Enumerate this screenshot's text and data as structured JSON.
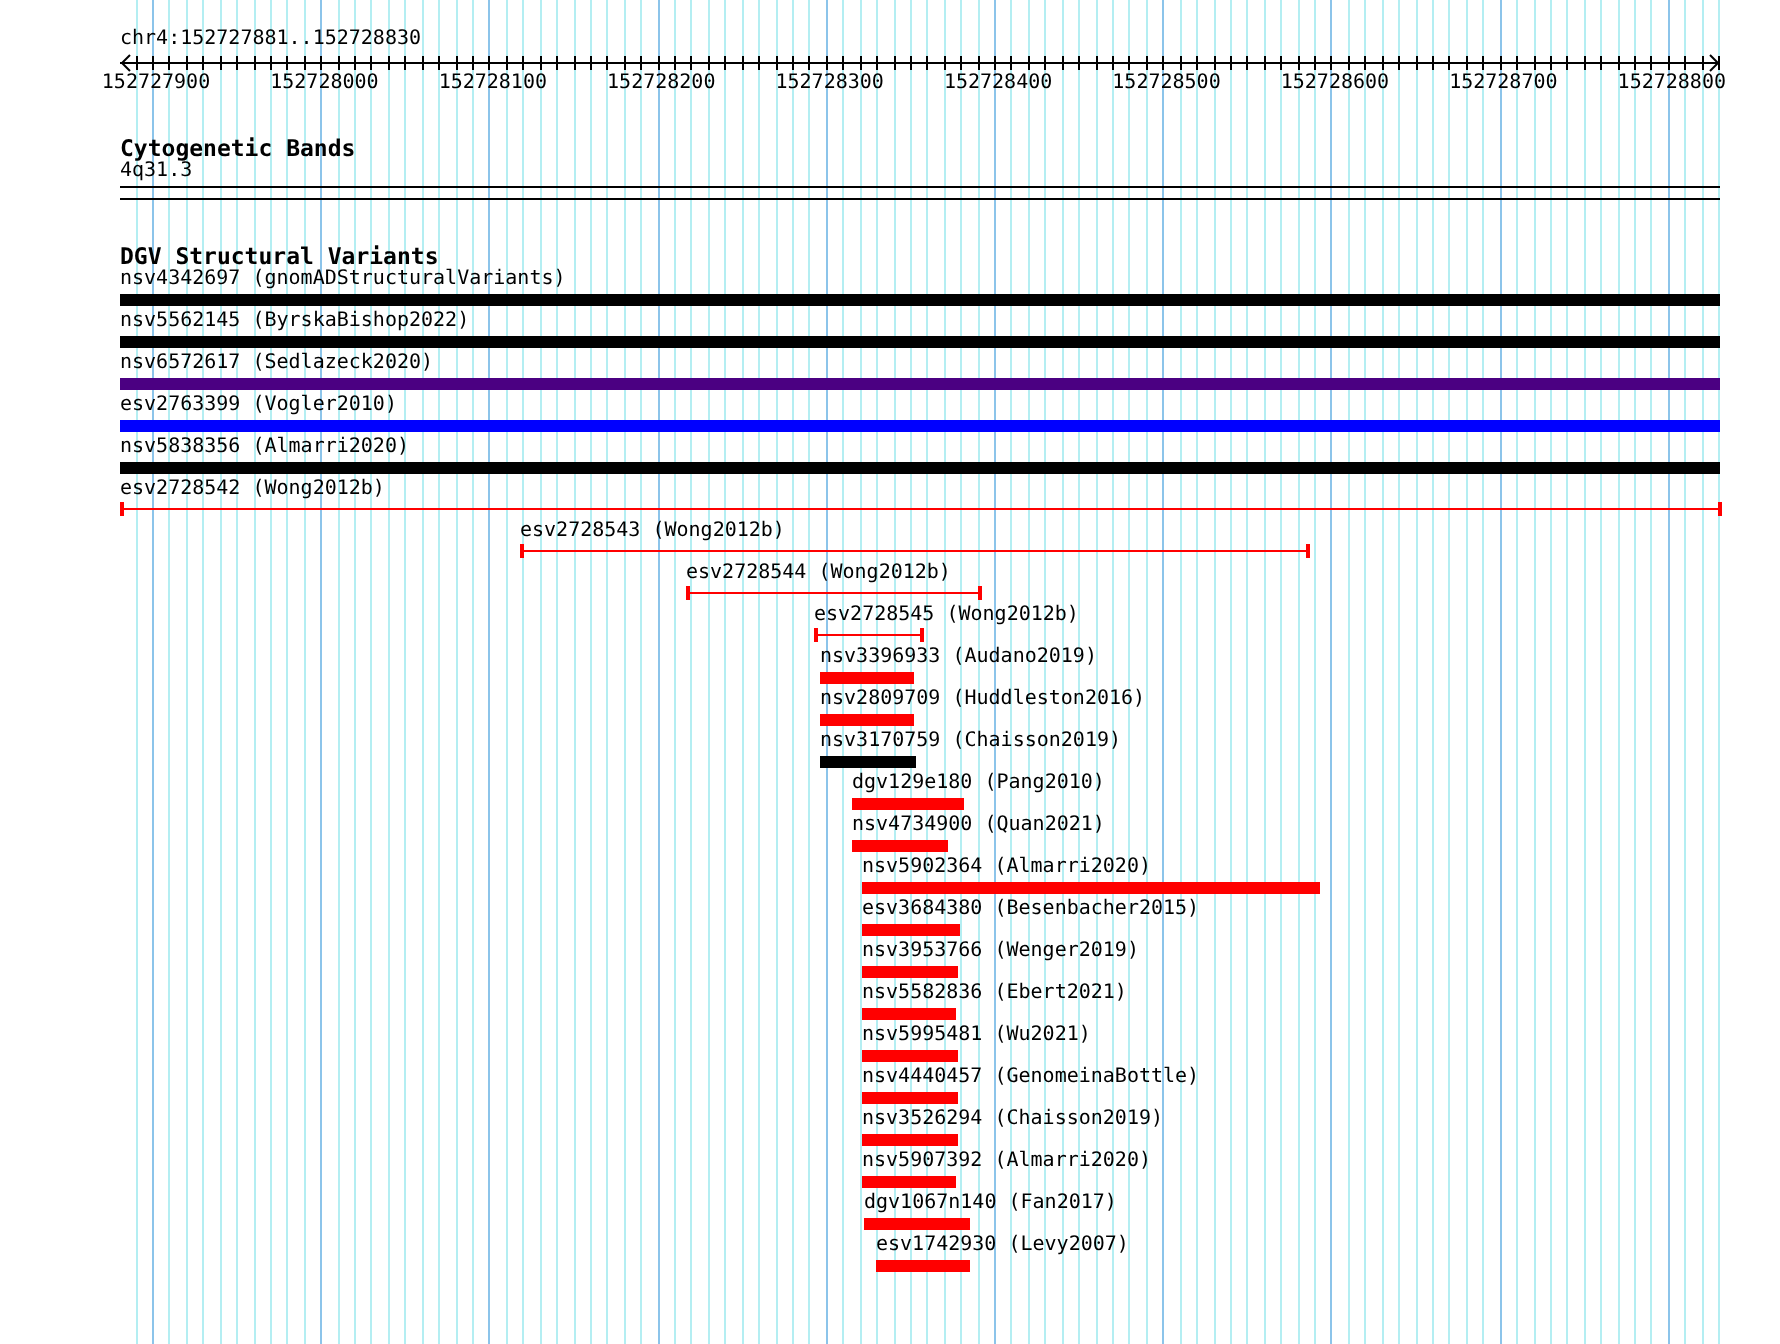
{
  "ruler": {
    "location": "chr4:152727881..152728830",
    "ticks": [
      "152727900",
      "152728000",
      "152728100",
      "152728200",
      "152728300",
      "152728400",
      "152728500",
      "152728600",
      "152728700",
      "152728800"
    ]
  },
  "tracks": [
    {
      "kind": "bands",
      "title": "Cytogenetic Bands",
      "bands": [
        {
          "name": "4q31.3"
        }
      ]
    },
    {
      "kind": "variants",
      "title": "DGV Structural Variants",
      "features": [
        {
          "label": "nsv4342697 (gnomADStructuralVariants)",
          "kind": "bar",
          "color": "#000000"
        },
        {
          "label": "nsv5562145 (ByrskaBishop2022)",
          "kind": "bar",
          "color": "#000000"
        },
        {
          "label": "nsv6572617 (Sedlazeck2020)",
          "kind": "bar",
          "color": "#4b0082"
        },
        {
          "label": "esv2763399 (Vogler2010)",
          "kind": "bar",
          "color": "#0000ff"
        },
        {
          "label": "nsv5838356 (Almarri2020)",
          "kind": "bar",
          "color": "#000000"
        },
        {
          "label": "esv2728542 (Wong2012b)",
          "kind": "range",
          "color": "#ff0000"
        },
        {
          "label": "esv2728543 (Wong2012b)",
          "kind": "range",
          "color": "#ff0000"
        },
        {
          "label": "esv2728544 (Wong2012b)",
          "kind": "range",
          "color": "#ff0000"
        },
        {
          "label": "esv2728545 (Wong2012b)",
          "kind": "range",
          "color": "#ff0000"
        },
        {
          "label": "nsv3396933 (Audano2019)",
          "kind": "bar",
          "color": "#ff0000"
        },
        {
          "label": "nsv2809709 (Huddleston2016)",
          "kind": "bar",
          "color": "#ff0000"
        },
        {
          "label": "nsv3170759 (Chaisson2019)",
          "kind": "bar",
          "color": "#000000"
        },
        {
          "label": "dgv129e180 (Pang2010)",
          "kind": "bar",
          "color": "#ff0000"
        },
        {
          "label": "nsv4734900 (Quan2021)",
          "kind": "bar",
          "color": "#ff0000"
        },
        {
          "label": "nsv5902364 (Almarri2020)",
          "kind": "bar",
          "color": "#ff0000"
        },
        {
          "label": "esv3684380 (Besenbacher2015)",
          "kind": "bar",
          "color": "#ff0000"
        },
        {
          "label": "nsv3953766 (Wenger2019)",
          "kind": "bar",
          "color": "#ff0000"
        },
        {
          "label": "nsv5582836 (Ebert2021)",
          "kind": "bar",
          "color": "#ff0000"
        },
        {
          "label": "nsv5995481 (Wu2021)",
          "kind": "bar",
          "color": "#ff0000"
        },
        {
          "label": "nsv4440457 (GenomeinaBottle)",
          "kind": "bar",
          "color": "#ff0000"
        },
        {
          "label": "nsv3526294 (Chaisson2019)",
          "kind": "bar",
          "color": "#ff0000"
        },
        {
          "label": "nsv5907392 (Almarri2020)",
          "kind": "bar",
          "color": "#ff0000"
        },
        {
          "label": "dgv1067n140 (Fan2017)",
          "kind": "bar",
          "color": "#ff0000"
        },
        {
          "label": "esv1742930 (Levy2007)",
          "kind": "bar",
          "color": "#ff0000"
        }
      ]
    }
  ]
}
